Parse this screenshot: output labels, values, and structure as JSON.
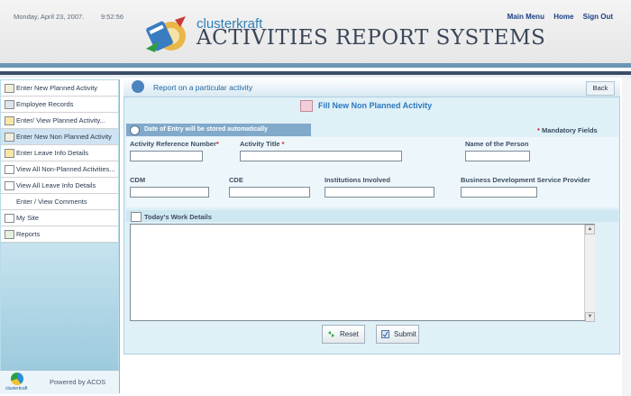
{
  "header": {
    "date": "Monday, April 23, 2007.",
    "time": "9:52:56",
    "nav": [
      {
        "label": "Main Menu"
      },
      {
        "label": "Home"
      },
      {
        "label": "Sign Out"
      }
    ],
    "brand_small": "clusterkraft",
    "brand_title": "ACTIVITIES REPORT SYSTEMS"
  },
  "sidebar": {
    "items": [
      {
        "label": "Enter New Planned Activity",
        "icon": "calendar-icon"
      },
      {
        "label": "Employee Records",
        "icon": "person-icon"
      },
      {
        "label": "Enter/ View Planned Activity...",
        "icon": "pencil-icon"
      },
      {
        "label": "Enter New Non Planned Activity",
        "icon": "calendar-edit-icon",
        "active": true
      },
      {
        "label": "Enter Leave Info Details",
        "icon": "pencil-icon"
      },
      {
        "label": "View All Non-Planned Activities...",
        "icon": "document-icon"
      },
      {
        "label": "View All Leave Info Details",
        "icon": "document-icon"
      },
      {
        "label": "Enter / View Comments",
        "icon": "comment-icon"
      },
      {
        "label": "My Site",
        "icon": "document-icon"
      },
      {
        "label": "Reports",
        "icon": "report-icon"
      }
    ],
    "footer_logo": "clusterkraft",
    "footer_text": "Powered by ACDS"
  },
  "main": {
    "title": "Report on a particular activity",
    "back_label": "Back",
    "subtitle": "Fill New Non Planned Activity",
    "info_text": "Date of Entry will be stored automatically",
    "mandatory_text": "Mandatory Fields",
    "fields": {
      "activity_ref": {
        "label": "Activity Reference Number",
        "value": ""
      },
      "activity_title": {
        "label": "Activity Title",
        "value": ""
      },
      "person_name": {
        "label": "Name of the Person",
        "value": ""
      },
      "cdm": {
        "label": "CDM",
        "value": ""
      },
      "cde": {
        "label": "CDE",
        "value": ""
      },
      "institutions": {
        "label": "Institutions Involved",
        "value": ""
      },
      "bdsp": {
        "label": "Business Development Service Provider",
        "value": ""
      }
    },
    "work_details_label": "Today's Work Details",
    "work_details_value": "",
    "reset_label": "Reset",
    "submit_label": "Submit"
  },
  "colors": {
    "accent": "#2b78c0",
    "sidebar": "#b7dbe9",
    "panel": "#dff0f7",
    "band_top": "#6a96b4",
    "band_dark": "#3c4c66"
  }
}
